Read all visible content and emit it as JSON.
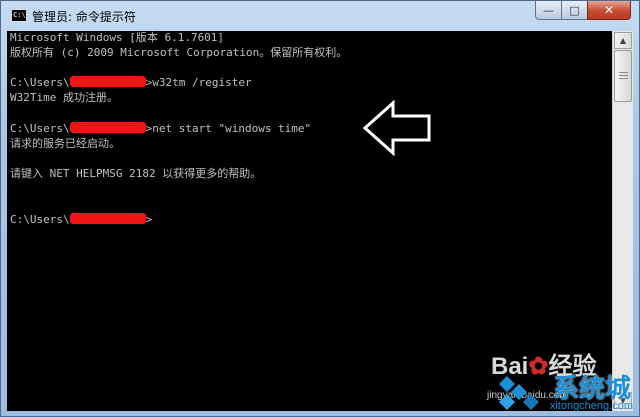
{
  "window": {
    "title": "管理员: 命令提示符",
    "icon_label": "C:\\",
    "buttons": {
      "minimize": "—",
      "maximize": "□",
      "close": "✕"
    }
  },
  "console": {
    "lines": [
      "Microsoft Windows [版本 6.1.7601]",
      "版权所有 (c) 2009 Microsoft Corporation。保留所有权利。",
      "",
      "C:\\Users\\",
      "W32Time 成功注册。",
      "",
      "C:\\Users\\",
      "请求的服务已经启动。",
      "",
      "请键入 NET HELPMSG 2182 以获得更多的帮助。",
      "",
      "",
      "C:\\Users\\"
    ],
    "prompt1_cmd": ">w32tm /register",
    "prompt2_cmd": ">net start \"windows time\"",
    "prompt3_cmd": ">"
  },
  "colors": {
    "console_bg": "#000000",
    "console_text": "#c0c0c0",
    "redaction": "#f01414"
  },
  "watermark": {
    "brand": "Bai",
    "brand_tail": "经验",
    "url": "jingyan.baidu.com",
    "site": "系统城",
    "site_url": "xitongcheng.com"
  }
}
